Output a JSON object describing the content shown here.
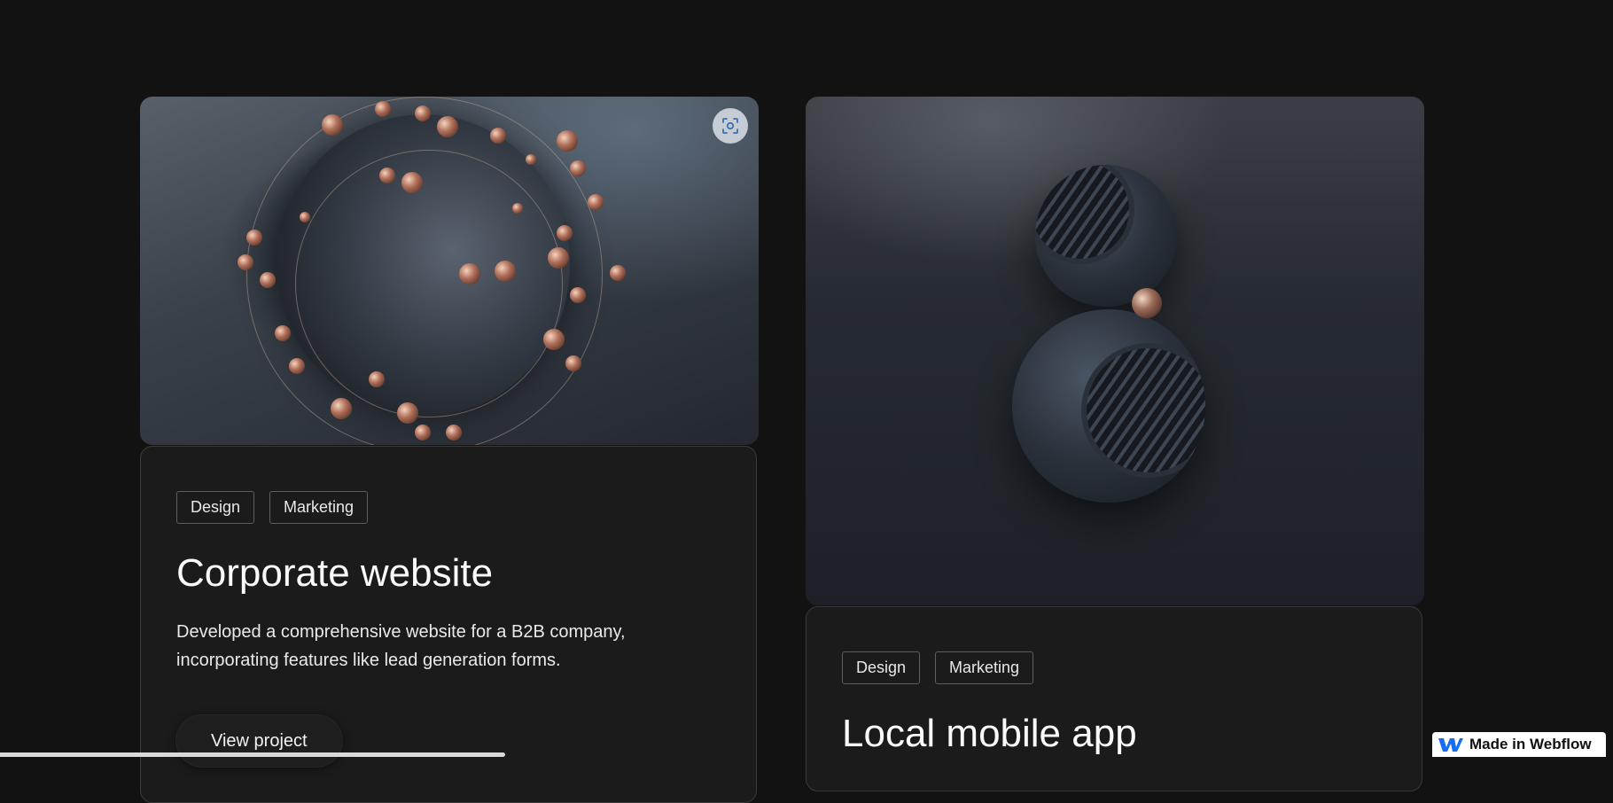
{
  "projects": [
    {
      "tags": [
        "Design",
        "Marketing"
      ],
      "title": "Corporate website",
      "description": "Developed a comprehensive website for a B2B company, incorporating features like lead generation forms.",
      "cta": "View project",
      "image_icon": "scan-icon"
    },
    {
      "tags": [
        "Design",
        "Marketing"
      ],
      "title": "Local mobile app"
    }
  ],
  "badge": {
    "label": "Made in Webflow",
    "icon": "webflow-logo-icon",
    "logo_color": "#146ef5"
  },
  "colors": {
    "background": "#121212",
    "panel": "#1b1b1b",
    "panel_border": "#3a3a3a"
  }
}
